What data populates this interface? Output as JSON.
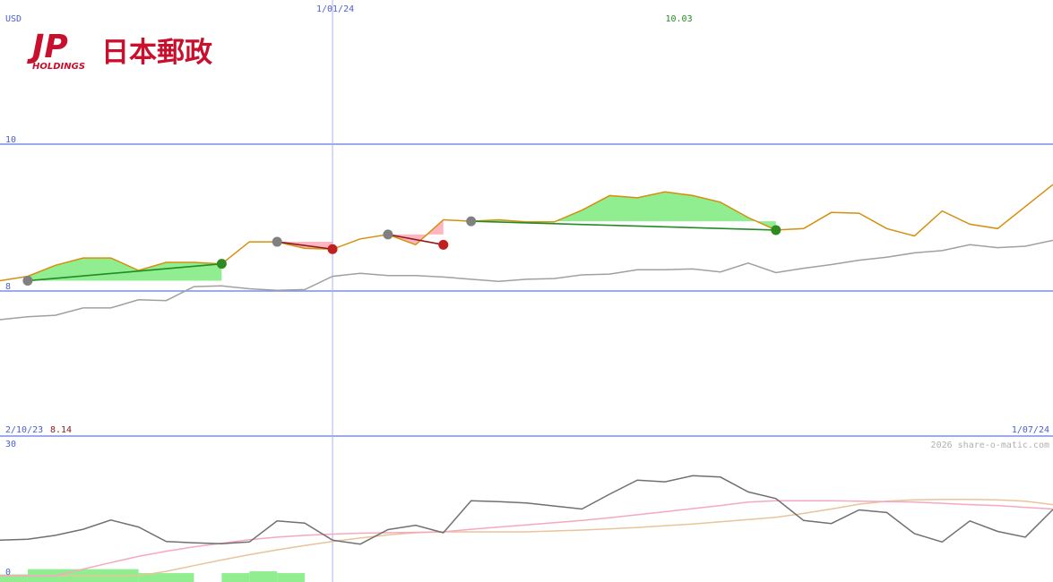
{
  "logo": {
    "mark": "JP",
    "sub": "HOLDINGS",
    "name": "日本郵政",
    "color": "#c8102e"
  },
  "chart_data": [
    {
      "type": "line",
      "panel": "price",
      "currency_label": "USD",
      "ylim": [
        8,
        10
      ],
      "yticks": [
        {
          "value": 10,
          "label": "10"
        },
        {
          "value": 8,
          "label": "8"
        }
      ],
      "x_range": [
        0,
        38
      ],
      "date_markers": [
        {
          "x": 12,
          "label": "1/01/24"
        }
      ],
      "start_label": "2/10/23",
      "start_value_label": "8.14",
      "end_label": "1/07/24",
      "high_label": "10.03",
      "high_x": 24.5,
      "series": [
        {
          "key": "price",
          "color": "#d4900c",
          "x": [
            0,
            1,
            2,
            3,
            4,
            5,
            6,
            7,
            8,
            9,
            10,
            11,
            12,
            13,
            14,
            15,
            16,
            17,
            18,
            19,
            20,
            21,
            22,
            23,
            24,
            25,
            26,
            27,
            28,
            29,
            30,
            31,
            32,
            33,
            34,
            35,
            36,
            37,
            38
          ],
          "values": [
            8.14,
            8.2,
            8.35,
            8.45,
            8.45,
            8.28,
            8.39,
            8.39,
            8.37,
            8.67,
            8.67,
            8.58,
            8.57,
            8.71,
            8.77,
            8.63,
            8.97,
            8.95,
            8.97,
            8.94,
            8.94,
            9.1,
            9.3,
            9.27,
            9.35,
            9.3,
            9.21,
            9.0,
            8.83,
            8.85,
            9.07,
            9.06,
            8.85,
            8.75,
            9.09,
            8.91,
            8.85,
            9.15,
            9.45
          ]
        },
        {
          "key": "comparison",
          "color": "#a0a0a0",
          "x": [
            0,
            1,
            2,
            3,
            4,
            5,
            6,
            7,
            8,
            9,
            10,
            11,
            12,
            13,
            14,
            15,
            16,
            17,
            18,
            19,
            20,
            21,
            22,
            23,
            24,
            25,
            26,
            27,
            28,
            29,
            30,
            31,
            32,
            33,
            34,
            35,
            36,
            37,
            38
          ],
          "values": [
            7.61,
            7.65,
            7.67,
            7.77,
            7.77,
            7.88,
            7.87,
            8.06,
            8.07,
            8.03,
            8.01,
            8.02,
            8.2,
            8.24,
            8.21,
            8.21,
            8.19,
            8.16,
            8.13,
            8.16,
            8.17,
            8.22,
            8.23,
            8.29,
            8.29,
            8.3,
            8.26,
            8.38,
            8.25,
            8.31,
            8.36,
            8.42,
            8.46,
            8.52,
            8.55,
            8.63,
            8.59,
            8.61,
            8.69
          ]
        }
      ],
      "trades": [
        {
          "from": [
            1,
            8.14
          ],
          "to": [
            8,
            8.37
          ],
          "result": "gain"
        },
        {
          "from": [
            10,
            8.67
          ],
          "to": [
            12,
            8.57
          ],
          "result": "loss"
        },
        {
          "from": [
            14,
            8.77
          ],
          "to": [
            16,
            8.63
          ],
          "result": "loss"
        },
        {
          "from": [
            17,
            8.95
          ],
          "to": [
            28,
            8.83
          ],
          "result": "gain"
        }
      ],
      "colors": {
        "gain_fill": "#90ee90",
        "loss_fill": "#ffb6c1",
        "gain_line": "#228b22",
        "loss_line": "#8b1a1a",
        "gridline": "#7b8ee8",
        "date_marker": "#a8b4f0",
        "dot_neutral": "#808080",
        "dot_gain": "#2e8b22",
        "dot_loss": "#c02020"
      }
    },
    {
      "type": "line",
      "panel": "indicator",
      "ylim": [
        0,
        30
      ],
      "yticks": [
        {
          "value": 30,
          "label": "30"
        },
        {
          "value": 0,
          "label": "0"
        }
      ],
      "credit": "2026 share-o-matic.com",
      "series": [
        {
          "key": "oscillator",
          "color": "#707070",
          "x": [
            0,
            1,
            2,
            3,
            4,
            5,
            6,
            7,
            8,
            9,
            10,
            11,
            12,
            13,
            14,
            15,
            16,
            17,
            18,
            19,
            20,
            21,
            22,
            23,
            24,
            25,
            26,
            27,
            28,
            29,
            30,
            31,
            32,
            33,
            34,
            35,
            36,
            37,
            38
          ],
          "values": [
            8.1,
            8.3,
            9.2,
            10.6,
            12.7,
            11.1,
            7.8,
            7.5,
            7.3,
            7.7,
            12.5,
            12,
            8.1,
            7.2,
            10.5,
            11.5,
            9.8,
            17.1,
            16.9,
            16.6,
            15.9,
            15.2,
            18.6,
            21.8,
            21.4,
            22.8,
            22.5,
            19.1,
            17.6,
            12.6,
            11.9,
            15,
            14.4,
            9.6,
            7.7,
            12.5,
            10.1,
            8.8,
            15.1
          ]
        },
        {
          "key": "average-fast",
          "color": "#f4a9bc",
          "x": [
            0,
            1,
            2,
            3,
            4,
            5,
            6,
            7,
            8,
            9,
            10,
            11,
            12,
            13,
            14,
            15,
            16,
            17,
            18,
            19,
            20,
            21,
            22,
            23,
            24,
            25,
            26,
            27,
            28,
            29,
            30,
            31,
            32,
            33,
            34,
            35,
            36,
            37,
            38
          ],
          "values": [
            0,
            0,
            0,
            1.5,
            3.0,
            4.4,
            5.6,
            6.6,
            7.4,
            8.2,
            8.8,
            9.2,
            9.5,
            9.7,
            9.8,
            9.9,
            10.0,
            10.6,
            11.1,
            11.6,
            12.1,
            12.6,
            13.2,
            13.9,
            14.6,
            15.3,
            16.0,
            16.8,
            17.1,
            17.1,
            17.1,
            17.0,
            16.9,
            16.8,
            16.5,
            16.2,
            16.0,
            15.6,
            15.2
          ]
        },
        {
          "key": "average-slow",
          "color": "#e8c49a",
          "x": [
            0,
            1,
            2,
            3,
            4,
            5,
            6,
            7,
            8,
            9,
            10,
            11,
            12,
            13,
            14,
            15,
            16,
            17,
            18,
            19,
            20,
            21,
            22,
            23,
            24,
            25,
            26,
            27,
            28,
            29,
            30,
            31,
            32,
            33,
            34,
            35,
            36,
            37,
            38
          ],
          "values": [
            0,
            0,
            0,
            0,
            0,
            0,
            1.0,
            2.3,
            3.6,
            4.8,
            5.9,
            6.9,
            7.8,
            8.6,
            9.3,
            9.8,
            10.0,
            10.0,
            10.0,
            10.0,
            10.2,
            10.4,
            10.7,
            11.0,
            11.4,
            11.8,
            12.3,
            12.8,
            13.3,
            14.2,
            15.2,
            16.3,
            17.0,
            17.3,
            17.4,
            17.4,
            17.3,
            17.0,
            16.2
          ]
        }
      ],
      "bars": [
        {
          "x0": 0,
          "x1": 1,
          "value": 0.3
        },
        {
          "x0": 1,
          "x1": 5,
          "value": 1.5
        },
        {
          "x0": 5,
          "x1": 7,
          "value": 0.6
        },
        {
          "x0": 8,
          "x1": 9,
          "value": 0.6
        },
        {
          "x0": 9,
          "x1": 10,
          "value": 1.0
        },
        {
          "x0": 10,
          "x1": 11,
          "value": 0.6
        }
      ],
      "bar_color": "#90ee90",
      "gridline": "#7b8ee8"
    }
  ]
}
